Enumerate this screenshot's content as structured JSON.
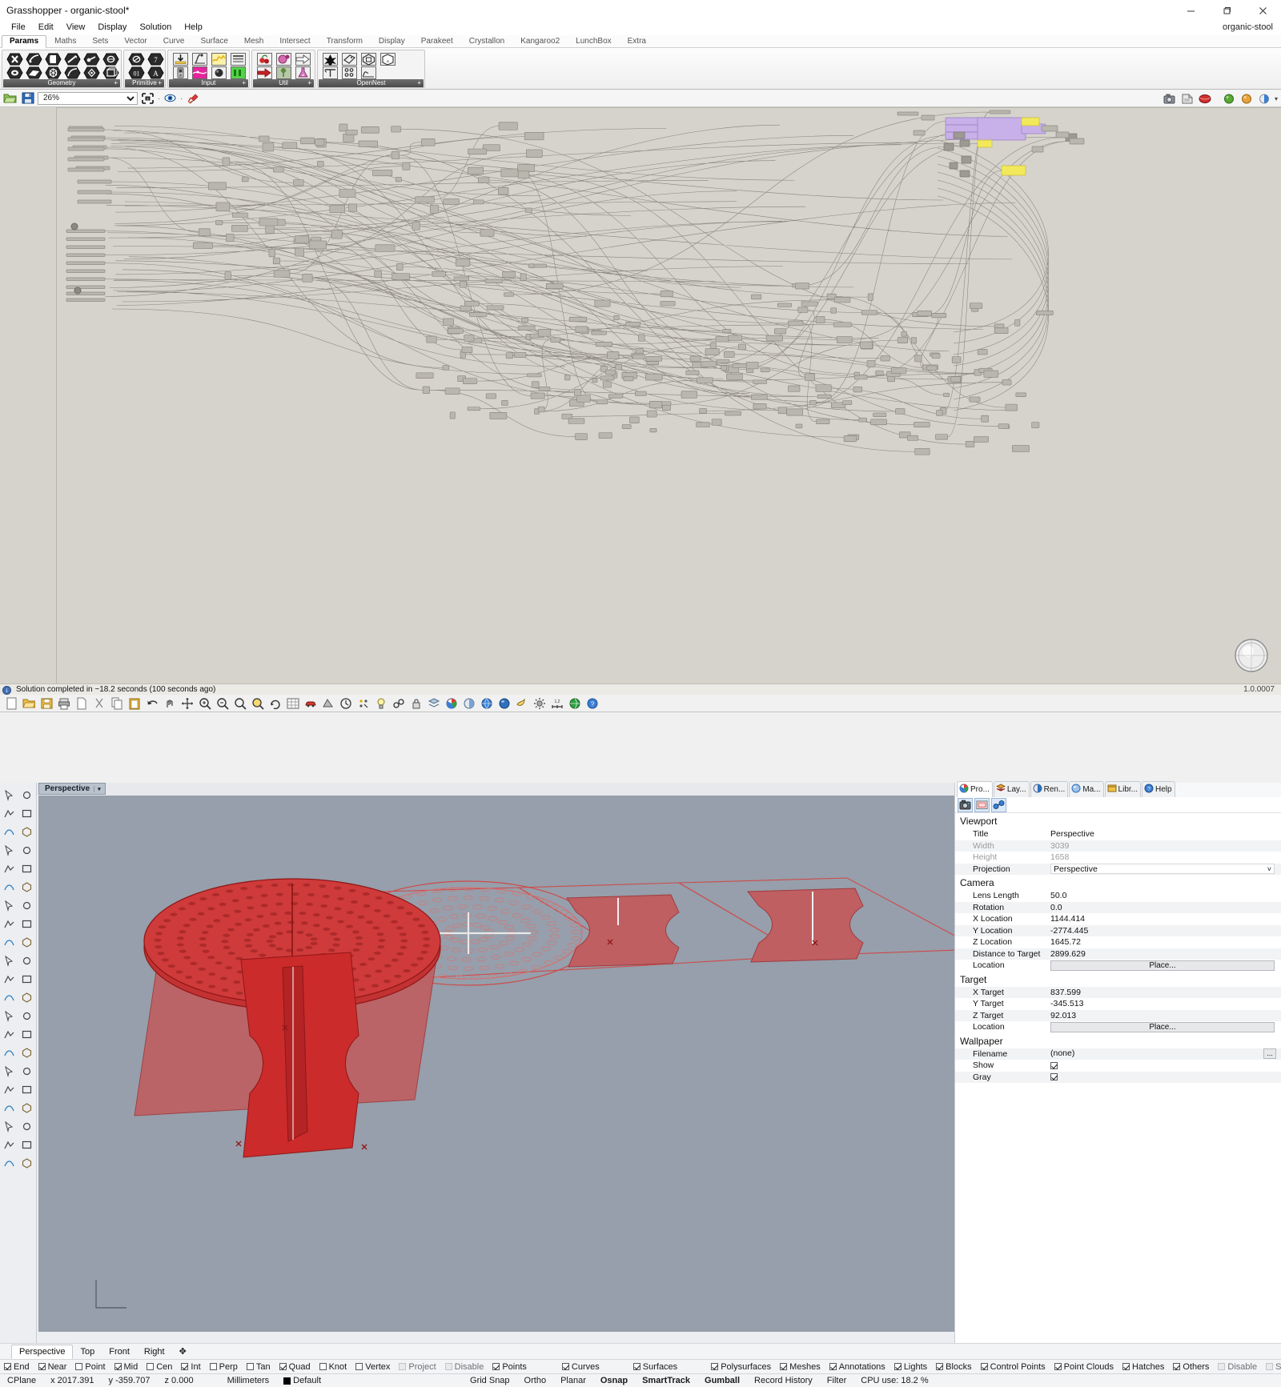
{
  "grasshopper": {
    "title": "Grasshopper - organic-stool*",
    "doc_name": "organic-stool",
    "window_buttons": {
      "minimize": "—",
      "maximize": "❐",
      "close": "✕"
    },
    "menu": [
      "File",
      "Edit",
      "View",
      "Display",
      "Solution",
      "Help"
    ],
    "tabs": [
      "Params",
      "Maths",
      "Sets",
      "Vector",
      "Curve",
      "Surface",
      "Mesh",
      "Intersect",
      "Transform",
      "Display",
      "Parakeet",
      "Crystallon",
      "Kangaroo2",
      "LunchBox",
      "Extra"
    ],
    "active_tab": "Params",
    "ribbon_groups": [
      {
        "label": "Geometry",
        "plus": "+"
      },
      {
        "label": "Primitive",
        "plus": "+"
      },
      {
        "label": "Input",
        "plus": "+"
      },
      {
        "label": "Util",
        "plus": "+"
      },
      {
        "label": "OpenNest",
        "plus": "+"
      }
    ],
    "canvas_toolbar": {
      "open_icon": "folder-open-icon",
      "save_icon": "save-icon",
      "zoom_value": "26%",
      "zoom_options": [
        "26%"
      ],
      "sketch_icon": "sketch-icon",
      "preview_icon": "preview-eye-icon",
      "paint_icon": "paint-icon"
    },
    "status": {
      "text": "Solution completed in ~18.2 seconds (100 seconds ago)",
      "version": "1.0.0007",
      "icon": "info-icon"
    }
  },
  "rhino": {
    "viewport": {
      "tab_label": "Perspective",
      "tab_carat": "▾"
    },
    "panel": {
      "tabs": [
        {
          "label": "Pro...",
          "icon": "properties-icon"
        },
        {
          "label": "Lay...",
          "icon": "layers-icon"
        },
        {
          "label": "Ren...",
          "icon": "render-icon"
        },
        {
          "label": "Ma...",
          "icon": "materials-icon"
        },
        {
          "label": "Libr...",
          "icon": "library-icon"
        },
        {
          "label": "Help",
          "icon": "help-icon"
        }
      ],
      "active_tab": "Pro...",
      "icon_row": [
        "camera-icon",
        "viewport-icon",
        "linked-icon"
      ],
      "sections": [
        {
          "title": "Viewport",
          "rows": [
            {
              "key": "Title",
              "value": "Perspective",
              "type": "text",
              "dim": false
            },
            {
              "key": "Width",
              "value": "3039",
              "type": "text",
              "dim": true
            },
            {
              "key": "Height",
              "value": "1658",
              "type": "text",
              "dim": true
            },
            {
              "key": "Projection",
              "value": "Perspective",
              "type": "combo",
              "dim": false
            }
          ]
        },
        {
          "title": "Camera",
          "rows": [
            {
              "key": "Lens Length",
              "value": "50.0",
              "type": "text",
              "dim": false
            },
            {
              "key": "Rotation",
              "value": "0.0",
              "type": "text",
              "dim": false
            },
            {
              "key": "X Location",
              "value": "1144.414",
              "type": "text",
              "dim": false
            },
            {
              "key": "Y Location",
              "value": "-2774.445",
              "type": "text",
              "dim": false
            },
            {
              "key": "Z Location",
              "value": "1645.72",
              "type": "text",
              "dim": false
            },
            {
              "key": "Distance to Target",
              "value": "2899.629",
              "type": "text",
              "dim": false
            },
            {
              "key": "Location",
              "value": "Place...",
              "type": "button",
              "dim": false
            }
          ]
        },
        {
          "title": "Target",
          "rows": [
            {
              "key": "X Target",
              "value": "837.599",
              "type": "text",
              "dim": false
            },
            {
              "key": "Y Target",
              "value": "-345.513",
              "type": "text",
              "dim": false
            },
            {
              "key": "Z Target",
              "value": "92.013",
              "type": "text",
              "dim": false
            },
            {
              "key": "Location",
              "value": "Place...",
              "type": "button",
              "dim": false
            }
          ]
        },
        {
          "title": "Wallpaper",
          "rows": [
            {
              "key": "Filename",
              "value": "(none)",
              "type": "dots",
              "dim": false
            },
            {
              "key": "Show",
              "value": "",
              "type": "checkbox",
              "checked": true,
              "dim": false
            },
            {
              "key": "Gray",
              "value": "",
              "type": "checkbox",
              "checked": true,
              "dim": false
            }
          ]
        }
      ]
    },
    "viewport_tabs": [
      {
        "label": "Perspective",
        "active": true
      },
      {
        "label": "Top",
        "active": false
      },
      {
        "label": "Front",
        "active": false
      },
      {
        "label": "Right",
        "active": false
      },
      {
        "label": "✥",
        "active": false
      }
    ],
    "osnap": [
      {
        "label": "End",
        "checked": true,
        "enabled": true
      },
      {
        "label": "Near",
        "checked": true,
        "enabled": true
      },
      {
        "label": "Point",
        "checked": false,
        "enabled": true
      },
      {
        "label": "Mid",
        "checked": true,
        "enabled": true
      },
      {
        "label": "Cen",
        "checked": false,
        "enabled": true
      },
      {
        "label": "Int",
        "checked": true,
        "enabled": true
      },
      {
        "label": "Perp",
        "checked": false,
        "enabled": true
      },
      {
        "label": "Tan",
        "checked": false,
        "enabled": true
      },
      {
        "label": "Quad",
        "checked": true,
        "enabled": true
      },
      {
        "label": "Knot",
        "checked": false,
        "enabled": true
      },
      {
        "label": "Vertex",
        "checked": false,
        "enabled": true
      },
      {
        "label": "Project",
        "checked": false,
        "enabled": false
      },
      {
        "label": "Disable",
        "checked": false,
        "enabled": false
      }
    ],
    "filters": [
      {
        "label": "Points",
        "checked": true,
        "enabled": true
      },
      {
        "label": "Curves",
        "checked": true,
        "enabled": true
      },
      {
        "label": "Surfaces",
        "checked": true,
        "enabled": true
      },
      {
        "label": "Polysurfaces",
        "checked": true,
        "enabled": true
      },
      {
        "label": "Meshes",
        "checked": true,
        "enabled": true
      },
      {
        "label": "Annotations",
        "checked": true,
        "enabled": true
      },
      {
        "label": "Lights",
        "checked": true,
        "enabled": true
      },
      {
        "label": "Blocks",
        "checked": true,
        "enabled": true
      },
      {
        "label": "Control Points",
        "checked": true,
        "enabled": true
      },
      {
        "label": "Point Clouds",
        "checked": true,
        "enabled": true
      },
      {
        "label": "Hatches",
        "checked": true,
        "enabled": true
      },
      {
        "label": "Others",
        "checked": true,
        "enabled": true
      },
      {
        "label": "Disable",
        "checked": false,
        "enabled": false
      },
      {
        "label": "Sub-objects",
        "checked": false,
        "enabled": false
      }
    ],
    "statusbar": {
      "cplane": "CPlane",
      "x": "x 2017.391",
      "y": "y -359.707",
      "z": "z 0.000",
      "units": "Millimeters",
      "layer": "Default",
      "toggles": [
        {
          "label": "Grid Snap",
          "bold": false
        },
        {
          "label": "Ortho",
          "bold": false
        },
        {
          "label": "Planar",
          "bold": false
        },
        {
          "label": "Osnap",
          "bold": true
        },
        {
          "label": "SmartTrack",
          "bold": true
        },
        {
          "label": "Gumball",
          "bold": true
        },
        {
          "label": "Record History",
          "bold": false
        },
        {
          "label": "Filter",
          "bold": false
        }
      ],
      "cpu": "CPU use: 18.2 %"
    }
  },
  "colors": {
    "gh_canvas": "#d6d3cc",
    "gh_node": "#b9b6ae",
    "gh_selected": "#c8b0e8",
    "gh_yellow": "#f2e85c",
    "rhino_viewport": "#969fab",
    "model_red": "#cc0000",
    "model_fill": "#bf5f62"
  }
}
